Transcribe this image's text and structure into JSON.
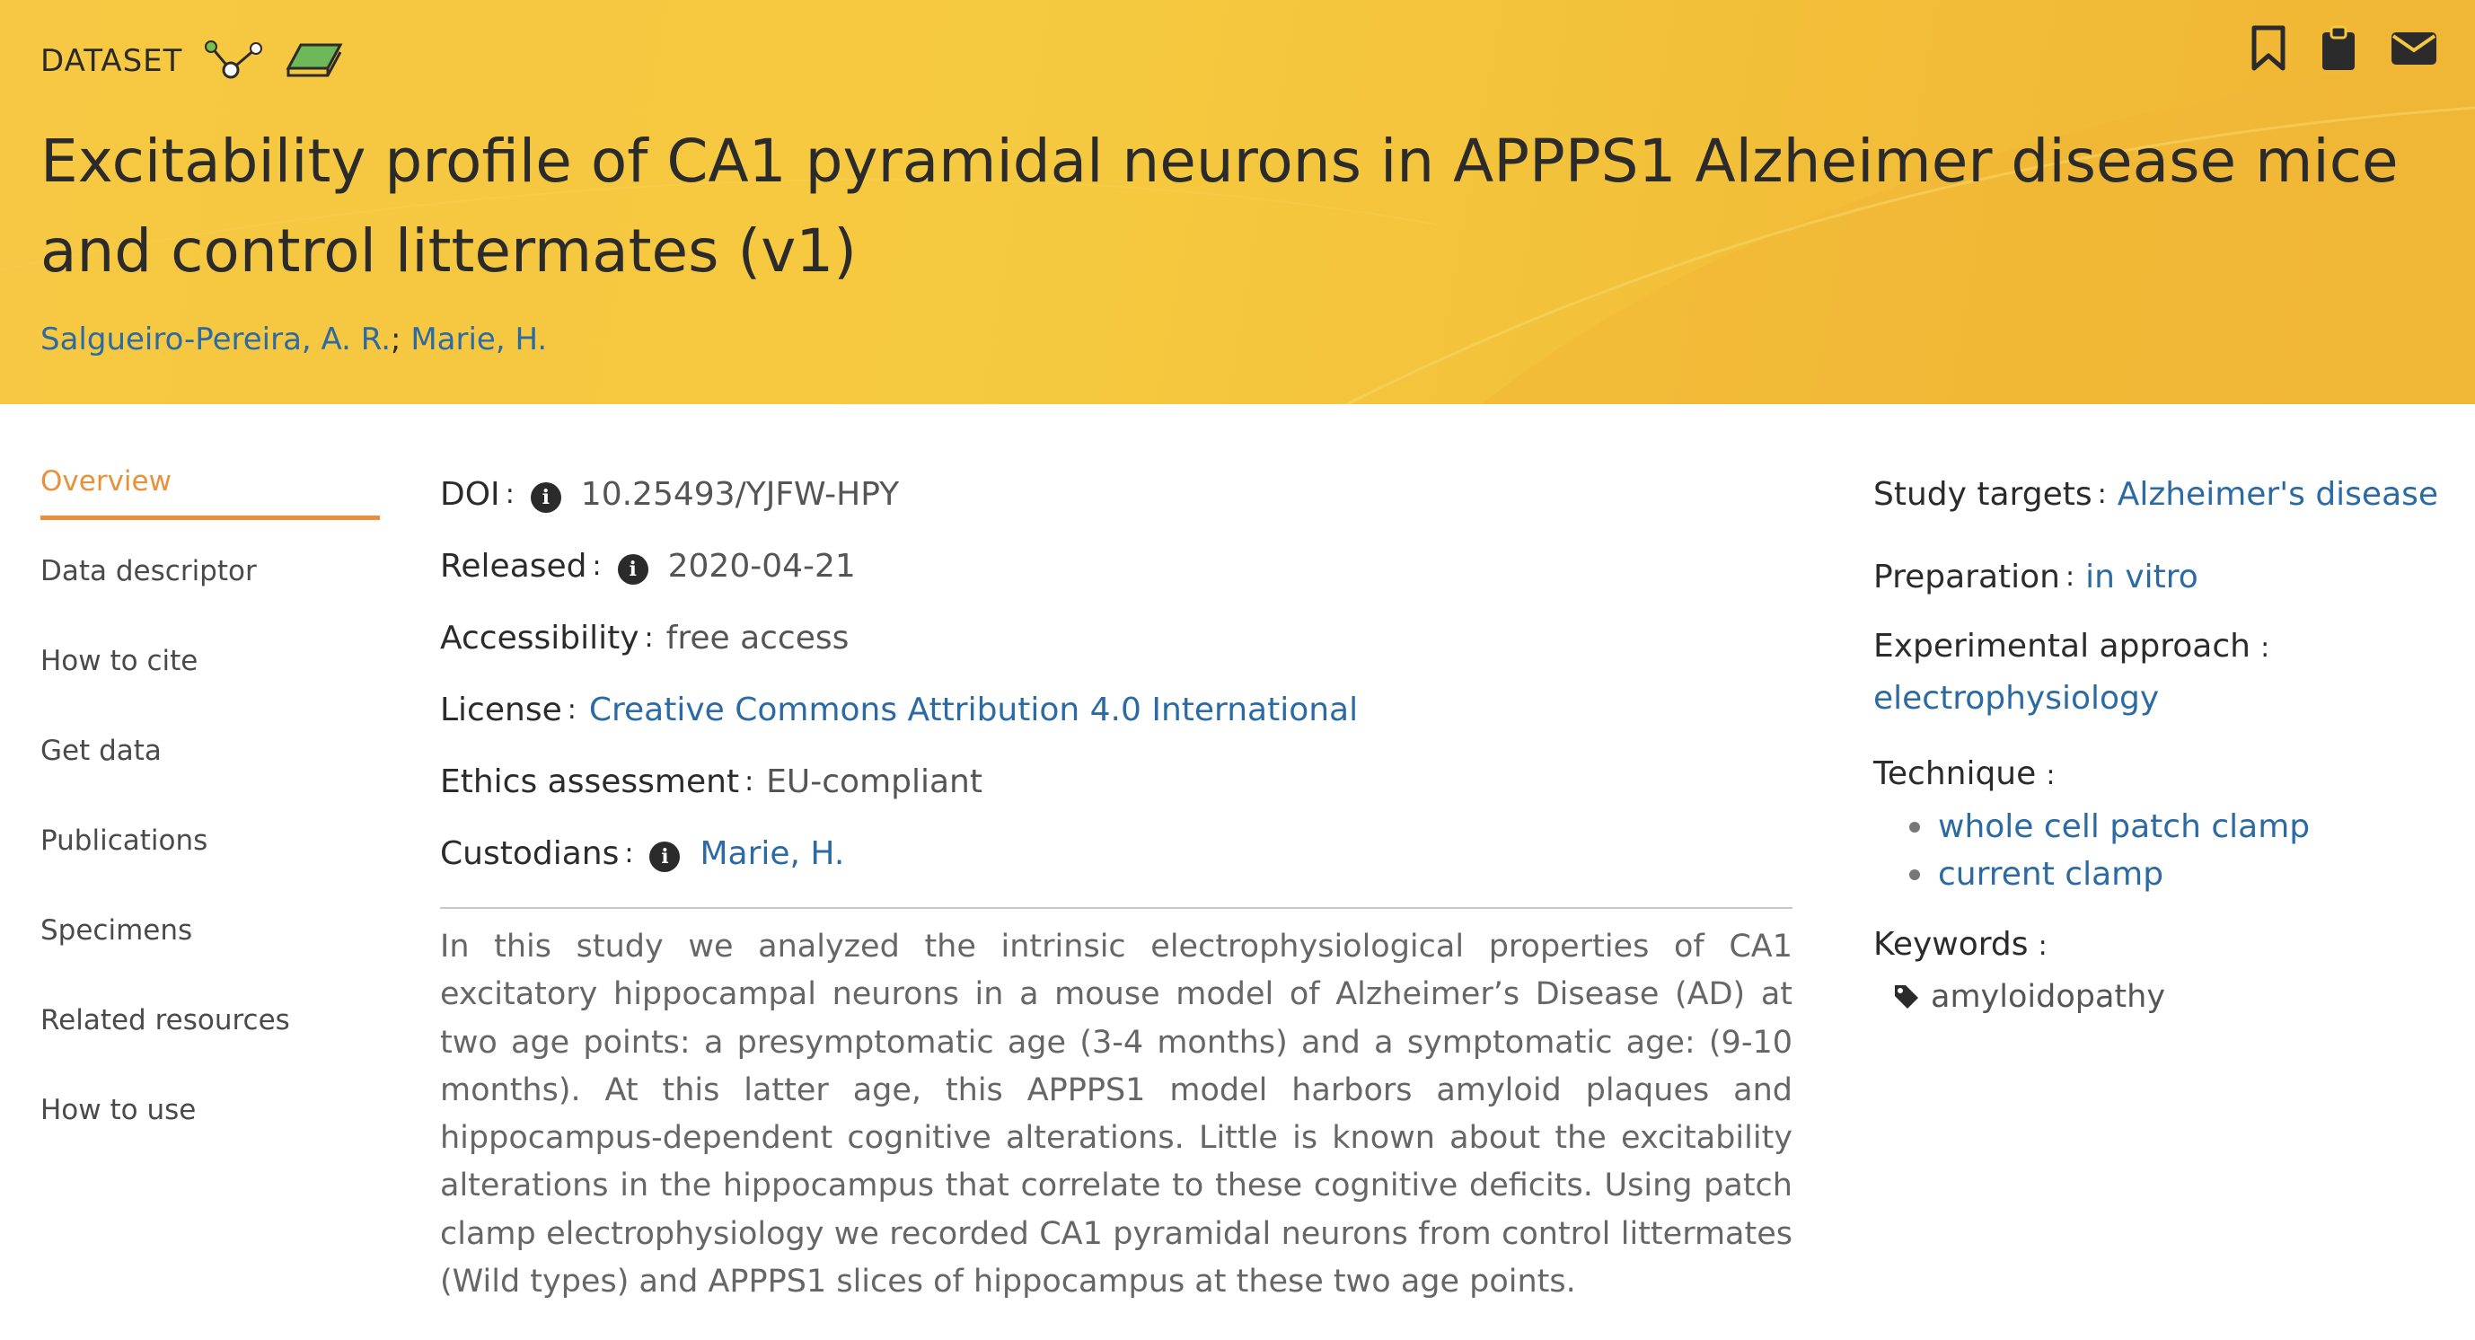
{
  "header": {
    "type_label": "DATASET",
    "title": "Excitability profile of CA1 pyramidal neurons in APPPS1 Alzheimer disease mice and control littermates (v1)",
    "authors": [
      "Salgueiro-Pereira, A. R.",
      "Marie, H."
    ],
    "author_separator": ";",
    "actions": [
      "bookmark-icon",
      "clipboard-icon",
      "envelope-icon"
    ]
  },
  "nav": {
    "items": [
      {
        "label": "Overview"
      },
      {
        "label": "Data descriptor"
      },
      {
        "label": "How to cite"
      },
      {
        "label": "Get data"
      },
      {
        "label": "Publications"
      },
      {
        "label": "Specimens"
      },
      {
        "label": "Related resources"
      },
      {
        "label": "How to use"
      }
    ],
    "active_color": "#e8913a"
  },
  "meta": {
    "doi": {
      "label": "DOI",
      "value": "10.25493/YJFW-HPY"
    },
    "released": {
      "label": "Released",
      "value": "2020-04-21"
    },
    "accessibility": {
      "label": "Accessibility",
      "value": "free access"
    },
    "license": {
      "label": "License",
      "value": "Creative Commons Attribution 4.0 International"
    },
    "ethics": {
      "label": "Ethics assessment",
      "value": "EU-compliant"
    },
    "custodians": {
      "label": "Custodians",
      "value": "Marie, H."
    },
    "colon": ":"
  },
  "abstract": "In this study we analyzed the intrinsic electrophysiological properties of CA1 excitatory hippocampal neurons in a mouse model of Alzheimer’s Disease (AD) at two age points: a presymptomatic age (3-4 months) and a symptomatic age: (9-10 months). At this latter age, this APPPS1 model harbors amyloid plaques and hippocampus-dependent cognitive alterations. Little is known about the excitability alterations in the hippocampus that correlate to these cognitive deficits.  Using patch clamp electrophysiology we recorded CA1 pyramidal neurons from control littermates (Wild types) and APPPS1 slices of hippocampus at these two age points.",
  "aside": {
    "study_targets": {
      "label": "Study targets",
      "value": "Alzheimer's disease"
    },
    "preparation": {
      "label": "Preparation",
      "value": "in vitro"
    },
    "approach": {
      "label": "Experimental approach",
      "value": "electrophysiology"
    },
    "technique": {
      "label": "Technique",
      "items": [
        "whole cell patch clamp",
        "current clamp"
      ]
    },
    "keywords": {
      "label": "Keywords",
      "items": [
        "amyloidopathy"
      ]
    },
    "colon": ":"
  },
  "colors": {
    "header_bg": "#f5c93f",
    "link": "#2b6aa3",
    "accent": "#e8913a"
  }
}
